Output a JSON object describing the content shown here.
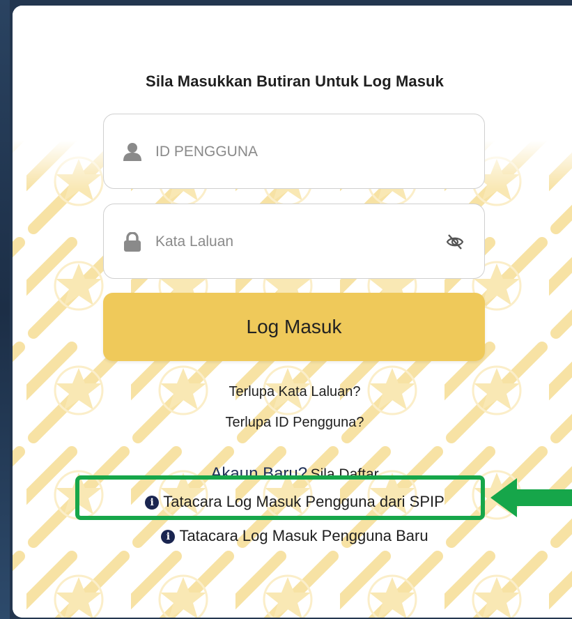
{
  "login": {
    "heading": "Sila Masukkan Butiran Untuk Log Masuk",
    "user_id_placeholder": "ID PENGGUNA",
    "password_placeholder": "Kata Laluan",
    "login_button": "Log Masuk",
    "forgot_password": "Terlupa Kata Laluan?",
    "forgot_user_id": "Terlupa ID Pengguna?",
    "new_account": "Akaun Baru?",
    "register": "Sila Daftar",
    "guide_spip": "Tatacara Log Masuk Pengguna dari SPIP",
    "guide_new_user": "Tatacara Log Masuk Pengguna Baru"
  },
  "icons": {
    "user": "user-icon",
    "lock": "lock-icon",
    "eye": "eye-slash-icon",
    "info": "info-circle-icon",
    "arrow": "arrow-left-icon"
  },
  "colors": {
    "login_button": "#efc95a",
    "pattern": "#f7e2a4",
    "highlight": "#16a64a",
    "page_background": "#23364f"
  }
}
